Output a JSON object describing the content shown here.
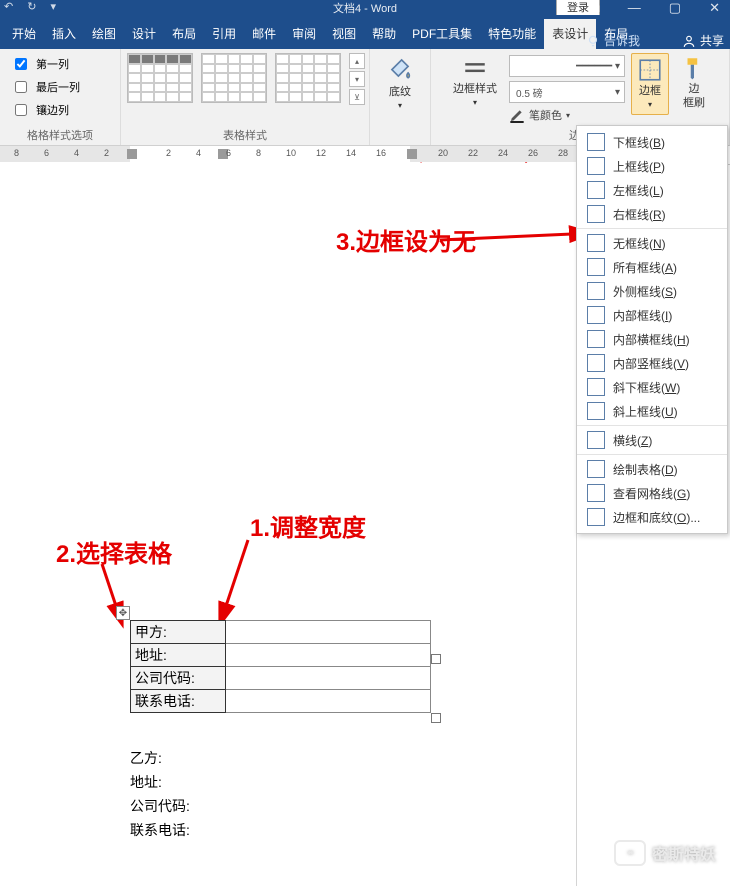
{
  "title": "文档4 - Word",
  "signin_label": "登录",
  "tabs": {
    "items": [
      "开始",
      "插入",
      "绘图",
      "设计",
      "布局",
      "引用",
      "邮件",
      "审阅",
      "视图",
      "帮助",
      "PDF工具集",
      "特色功能",
      "表设计",
      "布局"
    ],
    "active_index": 12
  },
  "tellme_label": "告诉我",
  "share_label": "共享",
  "style_options": {
    "first_col": "第一列",
    "last_col": "最后一列",
    "banded_col": "镶边列",
    "group_label": "格格样式选项"
  },
  "groups": {
    "table_styles": "表格样式",
    "shading": "底纹",
    "border_style": "边框样式",
    "borders": "边框",
    "border_group": "边框",
    "painter_l1": "边",
    "painter_l2": "框刷"
  },
  "border_width": "0.5 磅",
  "pen_color": "笔颜色",
  "ruler_numbers": [
    "8",
    "6",
    "4",
    "2",
    "2",
    "4",
    "6",
    "8",
    "10",
    "12",
    "14",
    "16",
    "20",
    "22",
    "24",
    "26",
    "28"
  ],
  "ruler_positions": [
    14,
    44,
    74,
    104,
    166,
    196,
    226,
    256,
    286,
    316,
    346,
    376,
    438,
    468,
    498,
    528,
    558
  ],
  "annotations": {
    "a1": "1.调整宽度",
    "a2": "2.选择表格",
    "a3": "3.边框设为无"
  },
  "doc_table": {
    "rows": [
      "甲方:",
      "地址:",
      "公司代码:",
      "联系电话:"
    ],
    "col1_w": 86,
    "col2_w": 196
  },
  "below_lines": [
    "乙方:",
    "地址:",
    "公司代码:",
    "联系电话:"
  ],
  "dropdown": [
    {
      "label": "下框线",
      "k": "B"
    },
    {
      "label": "上框线",
      "k": "P"
    },
    {
      "label": "左框线",
      "k": "L"
    },
    {
      "label": "右框线",
      "k": "R"
    },
    {
      "label": "无框线",
      "k": "N",
      "sep": true
    },
    {
      "label": "所有框线",
      "k": "A"
    },
    {
      "label": "外侧框线",
      "k": "S"
    },
    {
      "label": "内部框线",
      "k": "I"
    },
    {
      "label": "内部横框线",
      "k": "H"
    },
    {
      "label": "内部竖框线",
      "k": "V"
    },
    {
      "label": "斜下框线",
      "k": "W"
    },
    {
      "label": "斜上框线",
      "k": "U"
    },
    {
      "label": "横线",
      "k": "Z",
      "sep": true
    },
    {
      "label": "绘制表格",
      "k": "D",
      "sep": true
    },
    {
      "label": "查看网格线",
      "k": "G"
    },
    {
      "label": "边框和底纹",
      "k": "O",
      "ell": true
    }
  ],
  "watermark": "密斯特妖"
}
